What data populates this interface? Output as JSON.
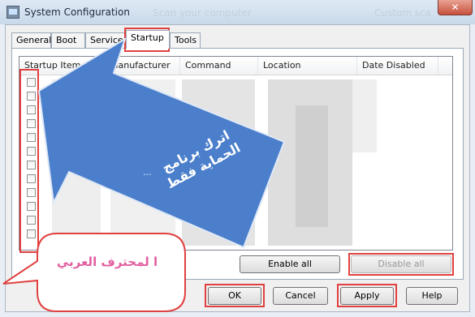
{
  "window": {
    "title": "System Configuration",
    "ghost_left": "Scan your computer",
    "ghost_right": "Custom sca",
    "close_glyph": "✕"
  },
  "tabs": [
    {
      "label": "General"
    },
    {
      "label": "Boot"
    },
    {
      "label": "Services"
    },
    {
      "label": "Startup"
    },
    {
      "label": "Tools"
    }
  ],
  "list": {
    "columns": [
      "Startup Item",
      "Manufacturer",
      "Command",
      "Location",
      "Date Disabled"
    ],
    "row_count": 12
  },
  "panel_buttons": {
    "enable_all": "Enable all",
    "disable_all": "Disable all"
  },
  "dialog_buttons": {
    "ok": "OK",
    "cancel": "Cancel",
    "apply": "Apply",
    "help": "Help"
  },
  "annotations": {
    "arrow_text": "اترك برنامج الحماية فقط",
    "arrow_dots": "...",
    "bubble_text": "ا لمحترف العربي"
  },
  "colors": {
    "highlight": "#e14040",
    "arrow_fill": "#4b7fcb",
    "bubble_text": "#e25fa0"
  }
}
